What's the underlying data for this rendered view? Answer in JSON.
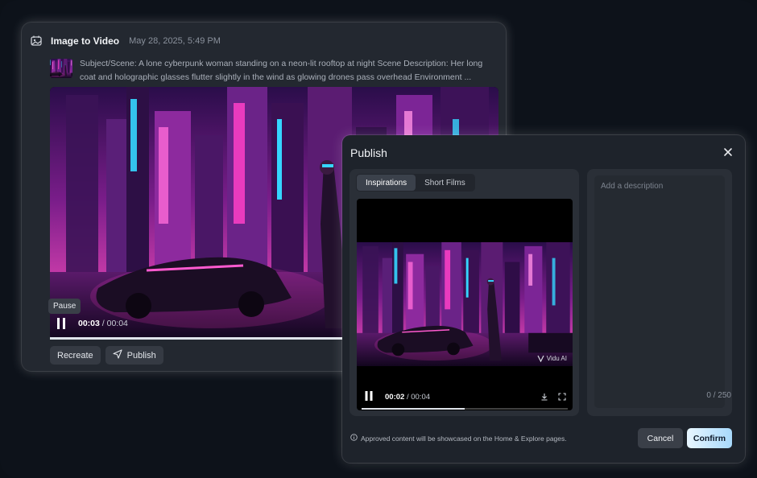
{
  "generation": {
    "title": "Image to Video",
    "timestamp": "May 28, 2025, 5:49 PM",
    "prompt": "Subject/Scene: A lone cyberpunk woman standing on a neon-lit rooftop at night Scene Description: Her long coat and holographic glasses flutter slightly in the wind as glowing drones pass overhead Environment ...",
    "tooltip": "Pause",
    "player": {
      "current_time": "00:03",
      "separator": " / ",
      "duration": "00:04",
      "progress": 0.75
    },
    "actions": {
      "recreate_label": "Recreate",
      "publish_label": "Publish"
    }
  },
  "publish_modal": {
    "title": "Publish",
    "tabs": [
      {
        "label": "Inspirations",
        "active": true
      },
      {
        "label": "Short Films",
        "active": false
      }
    ],
    "player": {
      "current_time": "00:02",
      "separator": " / ",
      "duration": "00:04",
      "progress": 0.5
    },
    "watermark": "Vidu AI",
    "description_placeholder": "Add a description",
    "char_counter": "0 / 250",
    "notice": "Approved content will be showcased on the Home & Explore pages.",
    "cancel_label": "Cancel",
    "confirm_label": "Confirm"
  },
  "colors": {
    "accent": "#a7d9fb",
    "neon_pink": "#ff3fc8",
    "neon_cyan": "#35d6ff"
  }
}
